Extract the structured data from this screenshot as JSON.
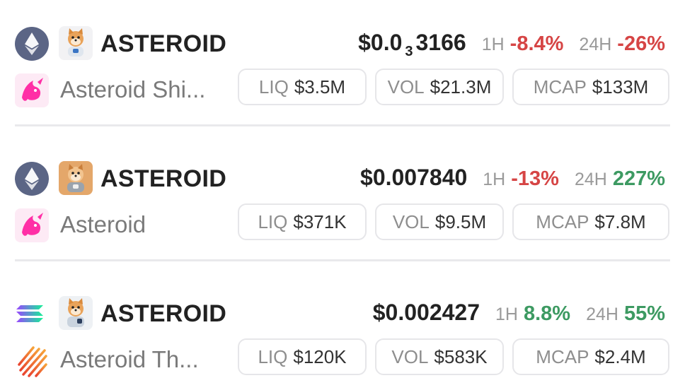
{
  "rows": [
    {
      "chain": "ethereum-icon",
      "dex": "uniswap-icon",
      "symbol": "ASTEROID",
      "name": "Asteroid Shi...",
      "price_main": "$0.0",
      "price_zeros": "3",
      "price_tail": "3166",
      "h1_label": "1H",
      "h1_value": "-8.4%",
      "h24_label": "24H",
      "h24_value": "-26%",
      "liq_label": "LIQ",
      "liq_value": "$3.5M",
      "vol_label": "VOL",
      "vol_value": "$21.3M",
      "mcap_label": "MCAP",
      "mcap_value": "$133M"
    },
    {
      "chain": "ethereum-icon",
      "dex": "uniswap-icon",
      "symbol": "ASTEROID",
      "name": "Asteroid",
      "price": "$0.007840",
      "h1_label": "1H",
      "h1_value": "-13%",
      "h24_label": "24H",
      "h24_value": "227%",
      "liq_label": "LIQ",
      "liq_value": "$371K",
      "vol_label": "VOL",
      "vol_value": "$9.5M",
      "mcap_label": "MCAP",
      "mcap_value": "$7.8M"
    },
    {
      "chain": "solana-icon",
      "dex": "raydium-icon",
      "symbol": "ASTEROID",
      "name": "Asteroid Th...",
      "price": "$0.002427",
      "h1_label": "1H",
      "h1_value": "8.8%",
      "h24_label": "24H",
      "h24_value": "55%",
      "liq_label": "LIQ",
      "liq_value": "$120K",
      "vol_label": "VOL",
      "vol_value": "$583K",
      "mcap_label": "MCAP",
      "mcap_value": "$2.4M"
    }
  ],
  "colors": {
    "negative": "#d64545",
    "positive": "#3d9a62",
    "uniswap": "#ff2fa6",
    "ethereum_bg": "#5b6585"
  }
}
